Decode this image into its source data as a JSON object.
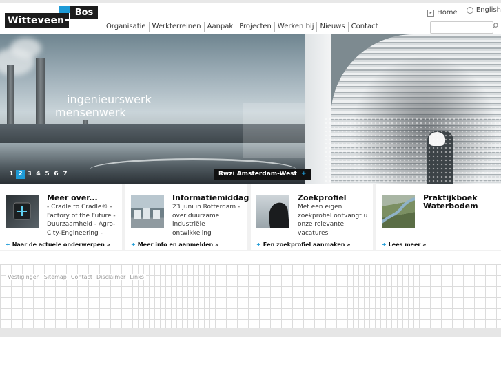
{
  "logo": {
    "word1": "Witteveen",
    "word2": "Bos"
  },
  "toplinks": {
    "home": "Home",
    "english": "English"
  },
  "nav": [
    "Organisatie",
    "Werkterreinen",
    "Aanpak",
    "Projecten",
    "Werken bij",
    "Nieuws",
    "Contact"
  ],
  "search": {
    "placeholder": ""
  },
  "hero": {
    "tagline_line1": "ingenieurswerk",
    "tagline_line2": "mensenwerk",
    "pages": [
      "1",
      "2",
      "3",
      "4",
      "5",
      "6",
      "7"
    ],
    "active_page": "2",
    "caption": "Rwzi Amsterdam-West",
    "caption_icon": "plus-icon"
  },
  "features": [
    {
      "title": "Meer over...",
      "text": "- Cradle to Cradle® - Factory of the Future - Duurzaamheid - Agro-City-Engineering -",
      "more": "Naar de actuele onderwerpen »"
    },
    {
      "title": "Informatiemiddag",
      "text": "23 juni in Rotterdam - over duurzame industriële ontwikkeling",
      "more": "Meer info en aanmelden »"
    },
    {
      "title": "Zoekprofiel",
      "text": "Met een eigen zoekprofiel ontvangt u onze relevante vacatures",
      "more": "Een zoekprofiel aanmaken »"
    },
    {
      "title": "Praktijkboek Waterbodem",
      "text": "",
      "more": "Lees meer »"
    }
  ],
  "footer": [
    "Vestigingen",
    "Sitemap",
    "Contact",
    "Disclaimer",
    "Links"
  ],
  "colors": {
    "accent": "#1e9bd7",
    "dark": "#1c1c1c"
  }
}
